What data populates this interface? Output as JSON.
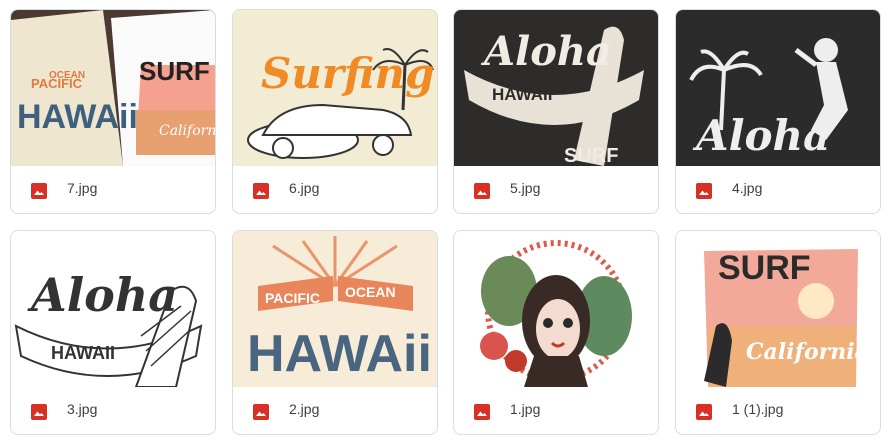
{
  "colors": {
    "image_icon": "#d93025",
    "border": "#dadce0",
    "text": "#3c4043"
  },
  "files": [
    {
      "name": "7.jpg",
      "icon": "image-file-icon",
      "thumb_text": [
        "SURF",
        "PACIFIC",
        "OCEAN",
        "HAWAii",
        "California"
      ]
    },
    {
      "name": "6.jpg",
      "icon": "image-file-icon",
      "thumb_text": [
        "Surfing"
      ]
    },
    {
      "name": "5.jpg",
      "icon": "image-file-icon",
      "thumb_text": [
        "Aloha",
        "HAWAII",
        "SURF"
      ]
    },
    {
      "name": "4.jpg",
      "icon": "image-file-icon",
      "thumb_text": [
        "Aloha"
      ]
    },
    {
      "name": "3.jpg",
      "icon": "image-file-icon",
      "thumb_text": [
        "Aloha",
        "HAWAII"
      ]
    },
    {
      "name": "2.jpg",
      "icon": "image-file-icon",
      "thumb_text": [
        "PACIFIC",
        "OCEAN",
        "HAWAii"
      ]
    },
    {
      "name": "1.jpg",
      "icon": "image-file-icon",
      "thumb_text": []
    },
    {
      "name": "1 (1).jpg",
      "icon": "image-file-icon",
      "thumb_text": [
        "SURF",
        "California"
      ]
    }
  ]
}
